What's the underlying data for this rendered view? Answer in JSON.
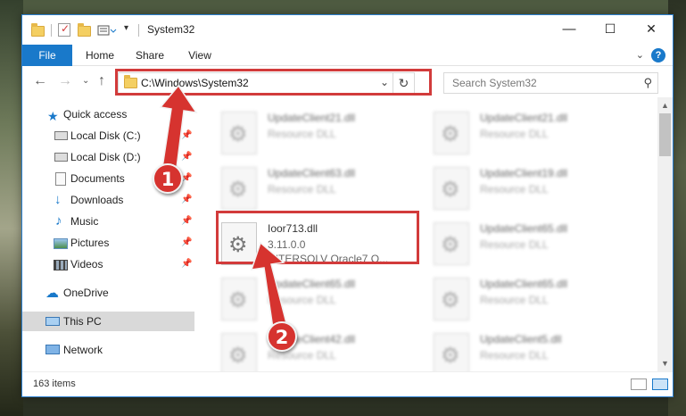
{
  "window": {
    "title": "System32",
    "controls": {
      "minimize": "—",
      "maximize": "☐",
      "close": "✕"
    }
  },
  "ribbon": {
    "tabs": [
      "File",
      "Home",
      "Share",
      "View"
    ],
    "help": "?"
  },
  "address": {
    "path": "C:\\Windows\\System32",
    "search_placeholder": "Search System32"
  },
  "nav": {
    "quick_access": "Quick access",
    "items": [
      {
        "label": "Local Disk (C:)",
        "icon": "drive-icon",
        "pinned": true
      },
      {
        "label": "Local Disk (D:)",
        "icon": "drive-icon",
        "pinned": true
      },
      {
        "label": "Documents",
        "icon": "documents-icon",
        "pinned": true
      },
      {
        "label": "Downloads",
        "icon": "downloads-icon",
        "pinned": true
      },
      {
        "label": "Music",
        "icon": "music-icon",
        "pinned": true
      },
      {
        "label": "Pictures",
        "icon": "pictures-icon",
        "pinned": true
      },
      {
        "label": "Videos",
        "icon": "videos-icon",
        "pinned": true
      }
    ],
    "onedrive": "OneDrive",
    "this_pc": "This PC",
    "network": "Network"
  },
  "files": [
    {
      "name": "UpdateClient21.dll",
      "desc": "Resource DLL"
    },
    {
      "name": "UpdateClient21.dll",
      "desc": "Resource DLL"
    },
    {
      "name": "UpdateClient63.dll",
      "desc": "Resource DLL"
    },
    {
      "name": "UpdateClient19.dll",
      "desc": "Resource DLL"
    },
    {
      "name": "UpdateClient65.dll",
      "desc": "Resource DLL"
    },
    {
      "name": "UpdateClient65.dll",
      "desc": "Resource DLL"
    },
    {
      "name": "UpdateClient65.dll",
      "desc": "Resource DLL"
    },
    {
      "name": "UpdateClient42.dll",
      "desc": "Resource DLL"
    },
    {
      "name": "UpdateClient5.dll",
      "desc": "Resource DLL"
    }
  ],
  "highlighted_file": {
    "name": "Ioor713.dll",
    "version": "3.11.0.0",
    "desc": "INTERSOLV Oracle7 O..."
  },
  "status": {
    "item_count": "163 items"
  },
  "callouts": {
    "step1": "1",
    "step2": "2"
  },
  "colors": {
    "accent": "#1979ca",
    "highlight": "#d23b3b",
    "badge": "#d6332f"
  }
}
